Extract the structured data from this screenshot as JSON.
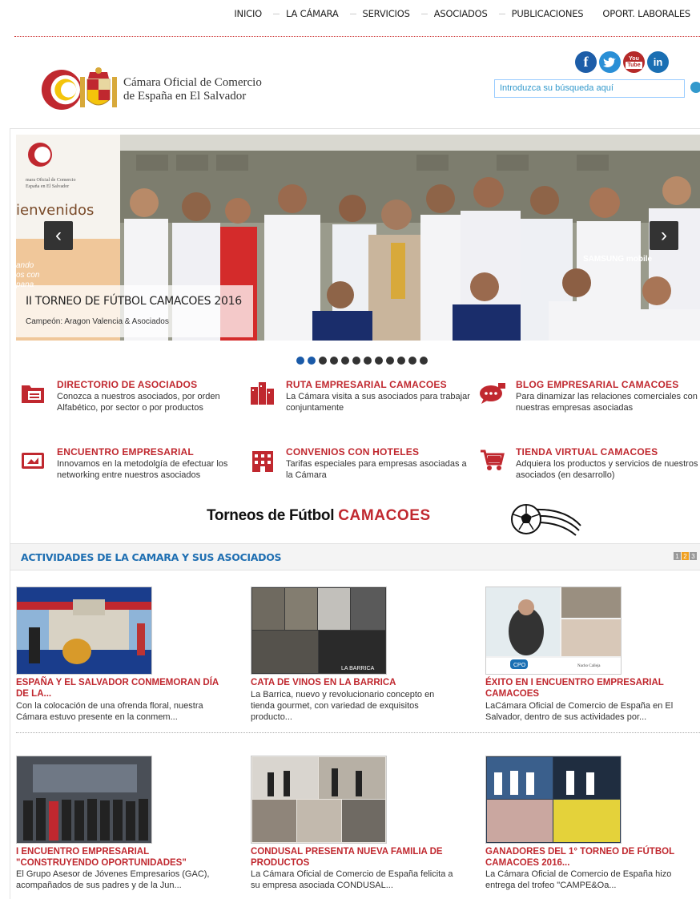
{
  "nav": {
    "items": [
      "INICIO",
      "LA CÁMARA",
      "SERVICIOS",
      "ASOCIADOS",
      "PUBLICACIONES",
      "OPORT. LABORALES"
    ]
  },
  "logo": {
    "line1": "Cámara Oficial de Comercio",
    "line2": "de España en El Salvador",
    "banner_lines": [
      "mara Oficial de Comercio",
      "España en El Salvador"
    ],
    "banner_word": "ienvenidos",
    "banner_small": [
      "ando",
      "os con",
      "pana"
    ]
  },
  "social": [
    {
      "icon": "facebook-icon",
      "glyph": "f",
      "color": "#1d5da8"
    },
    {
      "icon": "twitter-icon",
      "glyph": "t",
      "color": "#2a8fd6"
    },
    {
      "icon": "youtube-icon",
      "glyph": "You Tube",
      "color": "#b52a2a"
    },
    {
      "icon": "linkedin-icon",
      "glyph": "in",
      "color": "#1a6fb3"
    }
  ],
  "search": {
    "placeholder": "Introduzca su búsqueda aquí"
  },
  "slider": {
    "title": "II TORNEO DE FÚTBOL CAMACOES 2016",
    "subtitle": "Campeón: Aragon Valencia & Asociados",
    "jersey_text": "SAMSUNG mobile",
    "dots_total": 12,
    "active_dot": 2
  },
  "features": [
    {
      "title": "DIRECTORIO DE ASOCIADOS",
      "desc": "Conozca a nuestros asociados, por orden Alfabético, por sector o por productos",
      "icon": "folder-icon"
    },
    {
      "title": "RUTA EMPRESARIAL CAMACOES",
      "desc": "La Cámara visita a sus asociados para trabajar conjuntamente",
      "icon": "buildings-icon"
    },
    {
      "title": "BLOG EMPRESARIAL CAMACOES",
      "desc": "Para dinamizar las relaciones comerciales con nuestras empresas asociadas",
      "icon": "chat-bubble-icon"
    },
    {
      "title": "ENCUENTRO EMPRESARIAL",
      "desc": "Innovamos en la metodolgía de efectuar los networking entre nuestros asociados",
      "icon": "handshake-screen-icon"
    },
    {
      "title": "CONVENIOS CON HOTELES",
      "desc": "Tarifas especiales para empresas asociadas a la Cámara",
      "icon": "hotel-icon"
    },
    {
      "title": "TIENDA VIRTUAL CAMACOES",
      "desc": "Adquiera los productos y servicios de nuestros asociados (en desarrollo)",
      "icon": "shopping-cart-icon"
    }
  ],
  "banner": {
    "prefix": "Torneos de Fútbol ",
    "highlight": "CAMACOES"
  },
  "activities": {
    "heading": "ACTIVIDADES DE LA CAMARA Y SUS ASOCIADOS",
    "pages": [
      "1",
      "2",
      "3"
    ],
    "active_page": 1,
    "items": [
      {
        "title": "ESPAÑA Y EL SALVADOR CONMEMORAN DÍA DE LA...",
        "desc": "Con la colocación de una ofrenda floral, nuestra Cámara estuvo presente en la conmem..."
      },
      {
        "title": "CATA DE VINOS EN LA BARRICA",
        "desc": "La Barrica, nuevo y revolucionario concepto en tienda gourmet, con variedad de exquisitos producto...",
        "img_label": "LA BARRICA"
      },
      {
        "title": "ÉXITO EN I ENCUENTRO EMPRESARIAL CAMACOES",
        "desc": "LaCámara Oficial de Comercio de España en El Salvador, dentro de sus actividades por...",
        "img_labels": [
          "CPO",
          "Nacho Calleja"
        ]
      },
      {
        "title": "I ENCUENTRO EMPRESARIAL \"CONSTRUYENDO OPORTUNIDADES\"",
        "desc": "El Grupo Asesor de Jóvenes Empresarios (GAC), acompañados de sus padres y de la Jun..."
      },
      {
        "title": "CONDUSAL PRESENTA NUEVA FAMILIA DE PRODUCTOS",
        "desc": "La Cámara Oficial de Comercio de España felicita a su empresa asociada CONDUSAL..."
      },
      {
        "title": "GANADORES DEL 1° TORNEO DE FÚTBOL CAMACOES 2016...",
        "desc": "La Cámara Oficial de Comercio de España hizo entrega del trofeo \"CAMPE&Oa..."
      }
    ]
  }
}
